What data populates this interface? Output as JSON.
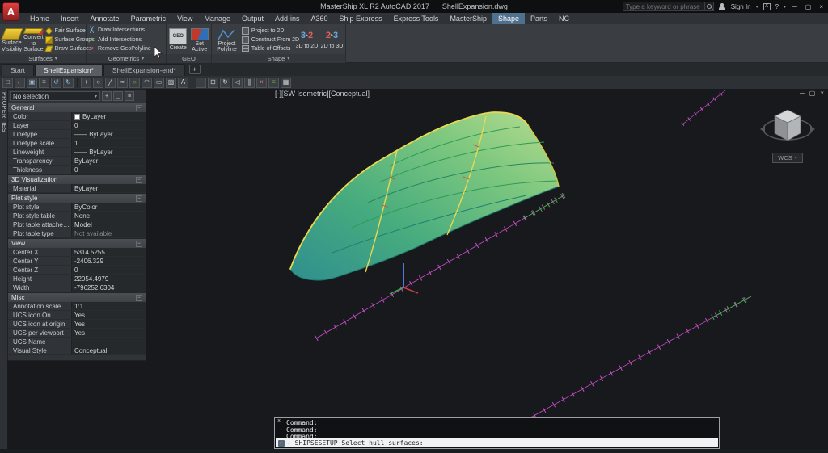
{
  "title_bar": {
    "logo": "A",
    "app_title": "MasterShip XL R2 AutoCAD 2017",
    "document_name": "ShellExpansion.dwg",
    "search_placeholder": "Type a keyword or phrase",
    "sign_in_label": "Sign In"
  },
  "menu": {
    "tabs": [
      "Home",
      "Insert",
      "Annotate",
      "Parametric",
      "View",
      "Manage",
      "Output",
      "Add-ins",
      "A360",
      "Ship Express",
      "Express Tools",
      "MasterShip",
      "Shape",
      "Parts",
      "NC"
    ],
    "active_tab": "Shape"
  },
  "ribbon": {
    "panels": {
      "surfaces": {
        "label": "Surfaces",
        "buttons": {
          "surface_visibility": "Surface Visibility",
          "convert_to_surface": "Convert to Surface",
          "fair_surface": "Fair Surface",
          "surface_groups": "Surface Groups",
          "draw_surfaces": "Draw Surfaces"
        }
      },
      "geometrics": {
        "label": "Geometrics",
        "buttons": {
          "draw_intersections": "Draw Intersections",
          "add_intersections": "Add Intersections",
          "remove_geopolyline": "Remove GeoPolyline"
        }
      },
      "geo": {
        "label": "GEO",
        "icon_text": "GEO",
        "buttons": {
          "create": "Create",
          "set_active": "Set Active"
        }
      },
      "shape": {
        "label": "Shape",
        "icon_3to2_left": "3",
        "icon_3to2_right": "2",
        "icon_2to3_left": "2",
        "icon_2to3_right": "3",
        "buttons": {
          "project_polyline": "Project Polyline",
          "project_to_2d": "Project to 2D",
          "construct_from_2d": "Construct From 2D",
          "table_of_offsets": "Table of Offsets",
          "to_2d": "3D to 2D",
          "to_3d": "2D to 3D"
        }
      }
    }
  },
  "file_tabs": {
    "tabs": [
      {
        "label": "Start",
        "active": false
      },
      {
        "label": "ShellExpansion*",
        "active": true
      },
      {
        "label": "ShellExpansion-end*",
        "active": false
      }
    ],
    "new_tab_glyph": "+"
  },
  "toolbar_icons": [
    {
      "name": "qnew",
      "glyph": "□",
      "color": "#cdd1d5"
    },
    {
      "name": "open",
      "glyph": "⌐",
      "color": "#d9b45a"
    },
    {
      "name": "save",
      "glyph": "▣",
      "color": "#9fb6d0"
    },
    {
      "name": "plot",
      "glyph": "≡",
      "color": "#cdd1d5"
    },
    {
      "name": "undo",
      "glyph": "↺",
      "color": "#8fc0e8"
    },
    {
      "name": "redo",
      "glyph": "↻",
      "color": "#8fc0e8"
    },
    {
      "sep": true
    },
    {
      "name": "pan",
      "glyph": "+",
      "color": "#cdd1d5"
    },
    {
      "name": "zoom",
      "glyph": "○",
      "color": "#cdd1d5"
    },
    {
      "name": "line",
      "glyph": "╱",
      "color": "#cdd1d5"
    },
    {
      "name": "polyline",
      "glyph": "≈",
      "color": "#cdd1d5"
    },
    {
      "name": "circle",
      "glyph": "○",
      "color": "#6cc24a"
    },
    {
      "name": "arc",
      "glyph": "◠",
      "color": "#cdd1d5"
    },
    {
      "name": "rectangle",
      "glyph": "▭",
      "color": "#cdd1d5"
    },
    {
      "name": "hatch",
      "glyph": "▨",
      "color": "#cdd1d5"
    },
    {
      "name": "text",
      "glyph": "A",
      "color": "#cdd1d5"
    },
    {
      "sep": true
    },
    {
      "name": "move",
      "glyph": "+",
      "color": "#cdd1d5"
    },
    {
      "name": "copy",
      "glyph": "⊞",
      "color": "#cdd1d5"
    },
    {
      "name": "rotate",
      "glyph": "↻",
      "color": "#cdd1d5"
    },
    {
      "name": "mirror",
      "glyph": "◁",
      "color": "#cdd1d5"
    },
    {
      "name": "offset",
      "glyph": "∥",
      "color": "#cdd1d5"
    },
    {
      "name": "erase",
      "glyph": "×",
      "color": "#d97b7b"
    },
    {
      "name": "layers",
      "glyph": "≡",
      "color": "#7fc24a"
    },
    {
      "name": "properties",
      "glyph": "▦",
      "color": "#cdd1d5"
    }
  ],
  "properties": {
    "palette_title": "PROPERTIES",
    "selection_value": "No selection",
    "sections": [
      {
        "title": "General",
        "rows": [
          {
            "label": "Color",
            "value": "ByLayer",
            "swatch": "#ffffff"
          },
          {
            "label": "Layer",
            "value": "0"
          },
          {
            "label": "Linetype",
            "value": "—— ByLayer"
          },
          {
            "label": "Linetype scale",
            "value": "1"
          },
          {
            "label": "Lineweight",
            "value": "—— ByLayer"
          },
          {
            "label": "Transparency",
            "value": "ByLayer"
          },
          {
            "label": "Thickness",
            "value": "0"
          }
        ]
      },
      {
        "title": "3D Visualization",
        "rows": [
          {
            "label": "Material",
            "value": "ByLayer"
          }
        ]
      },
      {
        "title": "Plot style",
        "rows": [
          {
            "label": "Plot style",
            "value": "ByColor"
          },
          {
            "label": "Plot style table",
            "value": "None"
          },
          {
            "label": "Plot table attached...",
            "value": "Model"
          },
          {
            "label": "Plot table type",
            "value": "Not available",
            "muted": true
          }
        ]
      },
      {
        "title": "View",
        "rows": [
          {
            "label": "Center X",
            "value": "5314.5255"
          },
          {
            "label": "Center Y",
            "value": "-2406.329"
          },
          {
            "label": "Center Z",
            "value": "0"
          },
          {
            "label": "Height",
            "value": "22054.4979"
          },
          {
            "label": "Width",
            "value": "-796252.6304"
          }
        ]
      },
      {
        "title": "Misc",
        "rows": [
          {
            "label": "Annotation scale",
            "value": "1:1"
          },
          {
            "label": "UCS icon On",
            "value": "Yes"
          },
          {
            "label": "UCS icon at origin",
            "value": "Yes"
          },
          {
            "label": "UCS per viewport",
            "value": "Yes"
          },
          {
            "label": "UCS Name",
            "value": ""
          },
          {
            "label": "Visual Style",
            "value": "Conceptual"
          }
        ]
      }
    ]
  },
  "viewport": {
    "label": "[-][SW Isometric][Conceptual]",
    "viewcube_label": "WCS"
  },
  "command_window": {
    "history": [
      "Command:",
      "Command:",
      "Command:"
    ],
    "prompt": "- SHIPSESETUP Select hull surfaces:"
  }
}
